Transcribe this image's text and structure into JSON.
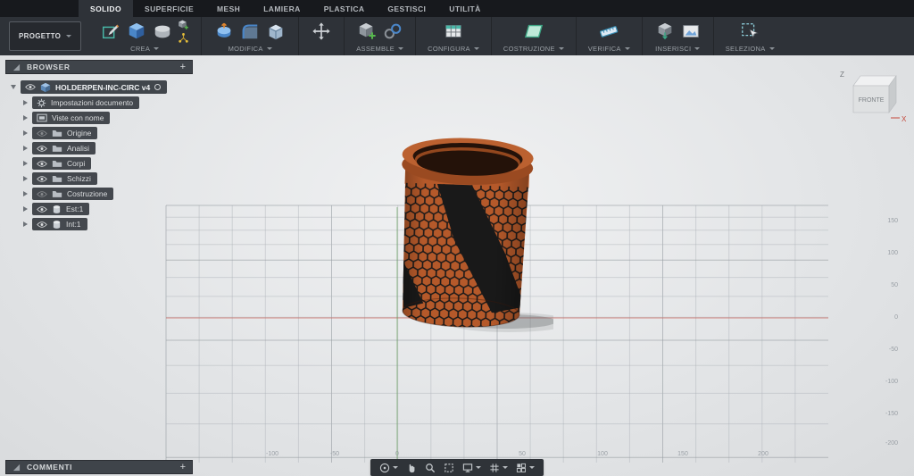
{
  "tab_bar": {
    "tabs": [
      "SOLIDO",
      "SUPERFICIE",
      "MESH",
      "LAMIERA",
      "PLASTICA",
      "GESTISCI",
      "UTILITÀ"
    ],
    "active_tab": "SOLIDO"
  },
  "toolbar": {
    "project_label": "PROGETTO",
    "groups": [
      {
        "label": "CREA",
        "icons": [
          "create-sketch-icon",
          "extrude-icon",
          "revolve-icon",
          "primitive-box-icon",
          "pattern-icon"
        ]
      },
      {
        "label": "MODIFICA",
        "icons": [
          "press-pull-icon",
          "fillet-icon",
          "shell-icon"
        ]
      },
      {
        "label": "ASSEMBLE",
        "icons": [
          "new-component-icon",
          "joint-icon"
        ]
      },
      {
        "label": "CONFIGURA",
        "icons": [
          "configure-table-icon"
        ]
      },
      {
        "label": "COSTRUZIONE",
        "icons": [
          "construction-plane-icon"
        ]
      },
      {
        "label": "VERIFICA",
        "icons": [
          "measure-icon"
        ]
      },
      {
        "label": "INSERISCI",
        "icons": [
          "insert-icon",
          "canvas-icon"
        ]
      },
      {
        "label": "SELEZIONA",
        "icons": [
          "select-icon"
        ]
      }
    ],
    "standalone_icons": [
      "move-icon"
    ]
  },
  "browser": {
    "header": "BROWSER",
    "add_label": "+",
    "root": {
      "label": "HOLDERPEN-INC-CIRC v4"
    },
    "items": [
      {
        "label": "Impostazioni documento",
        "icon": "gear-icon",
        "eye": "none"
      },
      {
        "label": "Viste con nome",
        "icon": "named-views-icon",
        "eye": "none"
      },
      {
        "label": "Origine",
        "icon": "folder-icon",
        "eye": "off"
      },
      {
        "label": "Analisi",
        "icon": "folder-icon",
        "eye": "on"
      },
      {
        "label": "Corpi",
        "icon": "folder-icon",
        "eye": "on"
      },
      {
        "label": "Schizzi",
        "icon": "folder-icon",
        "eye": "on"
      },
      {
        "label": "Costruzione",
        "icon": "folder-icon",
        "eye": "off"
      },
      {
        "label": "Est:1",
        "icon": "component-icon",
        "eye": "on"
      },
      {
        "label": "Int:1",
        "icon": "component-icon",
        "eye": "on"
      }
    ]
  },
  "viewcube": {
    "front_face": "FRONTE",
    "axis_z": "Z",
    "axis_x": "X"
  },
  "rulers": {
    "right": [
      "150",
      "100",
      "50",
      "0",
      "-50",
      "-100",
      "-150",
      "-200"
    ],
    "bottom": [
      "-100",
      "-50",
      "0",
      "50",
      "100",
      "150",
      "200"
    ]
  },
  "comments": {
    "header": "COMMENTI",
    "add_label": "+"
  },
  "nav_bar": {
    "icons": [
      "orbit-icon",
      "pan-icon",
      "zoom-icon",
      "fit-icon",
      "display-settings-icon",
      "grid-settings-icon",
      "viewports-icon"
    ]
  },
  "model": {
    "body_orange": "#b5592a",
    "pattern_black": "#191919",
    "axis_red": "#cc5045",
    "axis_green": "#5a9a50"
  }
}
